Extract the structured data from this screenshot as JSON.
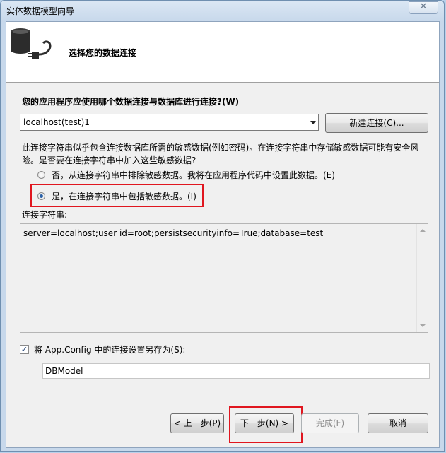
{
  "window": {
    "title": "实体数据模型向导",
    "close_glyph": "✕"
  },
  "header": {
    "title": "选择您的数据连接",
    "icon": "database-plug-icon"
  },
  "main": {
    "question": "您的应用程序应使用哪个数据连接与数据库进行连接?(W)",
    "connection_select": {
      "value": "localhost(test)1"
    },
    "new_connection_button": "新建连接(C)...",
    "sensitive_warning": "此连接字符串似乎包含连接数据库所需的敏感数据(例如密码)。在连接字符串中存储敏感数据可能有安全风险。是否要在连接字符串中加入这些敏感数据?",
    "options": [
      {
        "label": "否，从连接字符串中排除敏感数据。我将在应用程序代码中设置此数据。(E)",
        "checked": false
      },
      {
        "label": "是，在连接字符串中包括敏感数据。(I)",
        "checked": true
      }
    ],
    "connection_string_label": "连接字符串:",
    "connection_string": "server=localhost;user id=root;persistsecurityinfo=True;database=test",
    "save_checkbox": {
      "label": "将 App.Config 中的连接设置另存为(S):",
      "checked": true,
      "check_glyph": "✓"
    },
    "save_name": "DBModel"
  },
  "footer": {
    "prev_button": "< 上一步(P)",
    "next_button": "下一步(N) >",
    "finish_button": "完成(F)",
    "cancel_button": "取消"
  },
  "colors": {
    "highlight": "#e0161f",
    "radio_dot": "#2c62a8"
  }
}
